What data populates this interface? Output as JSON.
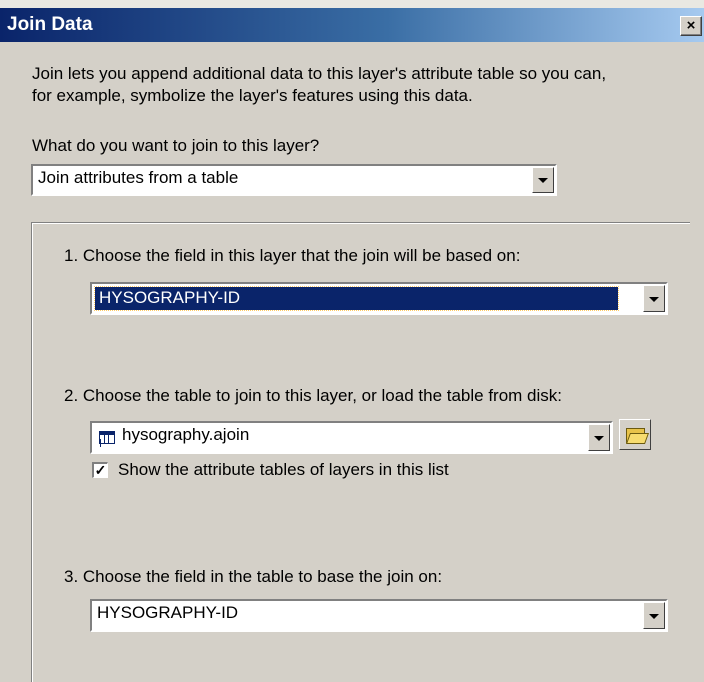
{
  "window": {
    "title": "Join Data",
    "close_glyph": "×"
  },
  "intro": {
    "line1": "Join lets you append additional data to this layer's attribute table so you can,",
    "line2": "for example, symbolize the layer's features using this data."
  },
  "question": {
    "label": "What do you want to join to this layer?",
    "selected": "Join attributes from a table"
  },
  "step1": {
    "label": "1.  Choose the field in this layer that the join will be based on:",
    "selected": "HYSOGRAPHY-ID"
  },
  "step2": {
    "label": "2.  Choose the table to join to this layer, or load the table from disk:",
    "selected": "hysography.ajoin",
    "table_icon": "table-icon",
    "browse_icon": "folder-open-icon",
    "checkbox_label": "Show the attribute tables of layers in this list",
    "checkbox_checked": true,
    "check_glyph": "✓"
  },
  "step3": {
    "label": "3.  Choose the field in the table to base the join on:",
    "selected": "HYSOGRAPHY-ID"
  },
  "colors": {
    "dialog_bg": "#d4d0c8",
    "title_bar": "#0a246a",
    "selection": "#0a246a"
  }
}
